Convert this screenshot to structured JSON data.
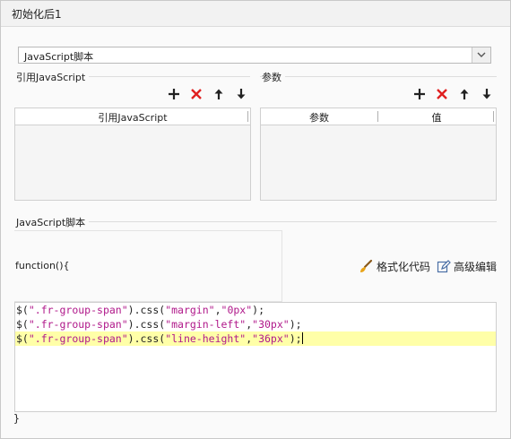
{
  "dialog": {
    "title": "初始化后1"
  },
  "script_type": {
    "selected": "JavaScript脚本"
  },
  "ref_js": {
    "section_label": "引用JavaScript",
    "column_header": "引用JavaScript",
    "rows": []
  },
  "params": {
    "section_label": "参数",
    "column_headers": [
      "参数",
      "值"
    ],
    "rows": []
  },
  "toolbar_icons": [
    "add-icon",
    "delete-icon",
    "move-up-icon",
    "move-down-icon"
  ],
  "script_section": {
    "label": "JavaScript脚本",
    "function_header": "function(){",
    "format_label": "格式化代码",
    "advanced_label": "高级编辑",
    "closing": "}",
    "code_lines": [
      {
        "p1": "$(",
        "s1": "\".fr-group-span\"",
        "p2": ").css(",
        "s2": "\"margin\"",
        "p3": ",",
        "s3": "\"0px\"",
        "p4": ");"
      },
      {
        "p1": "$(",
        "s1": "\".fr-group-span\"",
        "p2": ").css(",
        "s2": "\"margin-left\"",
        "p3": ",",
        "s3": "\"30px\"",
        "p4": ");"
      },
      {
        "p1": "$(",
        "s1": "\".fr-group-span\"",
        "p2": ").css(",
        "s2": "\"line-height\"",
        "p3": ",",
        "s3": "\"36px\"",
        "p4": ");"
      }
    ]
  },
  "colors": {
    "string": "#b0188a",
    "delete_red": "#e02020",
    "active_line": "#ffffa8"
  }
}
